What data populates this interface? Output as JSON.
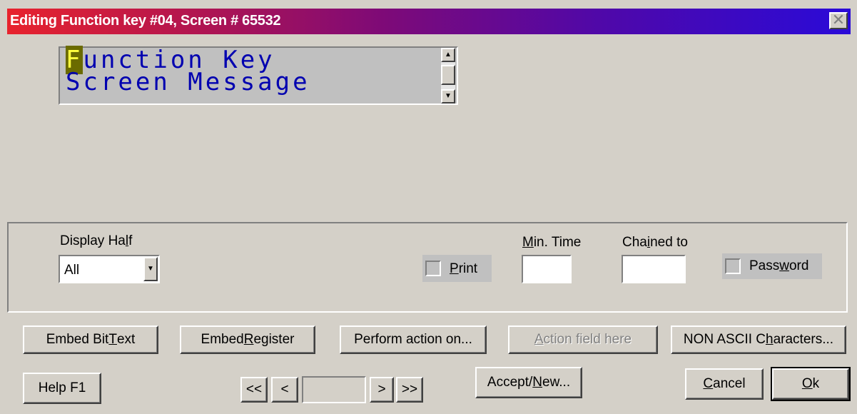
{
  "window": {
    "title": "Editing Function key #04, Screen # 65532",
    "close_glyph": "✕"
  },
  "lcd": {
    "cursor_char": "F",
    "line1_rest": "unction Key",
    "line2": "Screen Message",
    "scroll_up_glyph": "▲",
    "scroll_down_glyph": "▼"
  },
  "options": {
    "display_half_label_pre": "Display Ha",
    "display_half_label_accel": "l",
    "display_half_label_post": "f",
    "display_half_value": "All",
    "dropdown_glyph": "▼",
    "print_label_accel": "P",
    "print_label_post": "rint",
    "min_time_label_accel": "M",
    "min_time_label_post": "in. Time",
    "min_time_value": "",
    "chained_to_label_pre": "Cha",
    "chained_to_label_accel": "i",
    "chained_to_label_post": "ned to",
    "chained_to_value": "",
    "password_label_pre": "Pass",
    "password_label_accel": "w",
    "password_label_post": "ord"
  },
  "buttons": {
    "embed_bit_text_pre": "Embed Bit ",
    "embed_bit_text_accel": "T",
    "embed_bit_text_post": "ext",
    "embed_register_pre": "Embed ",
    "embed_register_accel": "R",
    "embed_register_post": "egister",
    "perform_action": "Perform action on...",
    "action_field_here_pre": "",
    "action_field_here_accel": "A",
    "action_field_here_post": "ction field here",
    "non_ascii_pre": "NON ASCII C",
    "non_ascii_accel": "h",
    "non_ascii_post": "aracters...",
    "help": "Help F1",
    "nav_first": "<<",
    "nav_prev": "<",
    "nav_position": "",
    "nav_next": ">",
    "nav_last": ">>",
    "accept_new_pre": "Accept/",
    "accept_new_accel": "N",
    "accept_new_post": "ew...",
    "cancel_accel": "C",
    "cancel_post": "ancel",
    "ok_accel": "O",
    "ok_post": "k"
  }
}
